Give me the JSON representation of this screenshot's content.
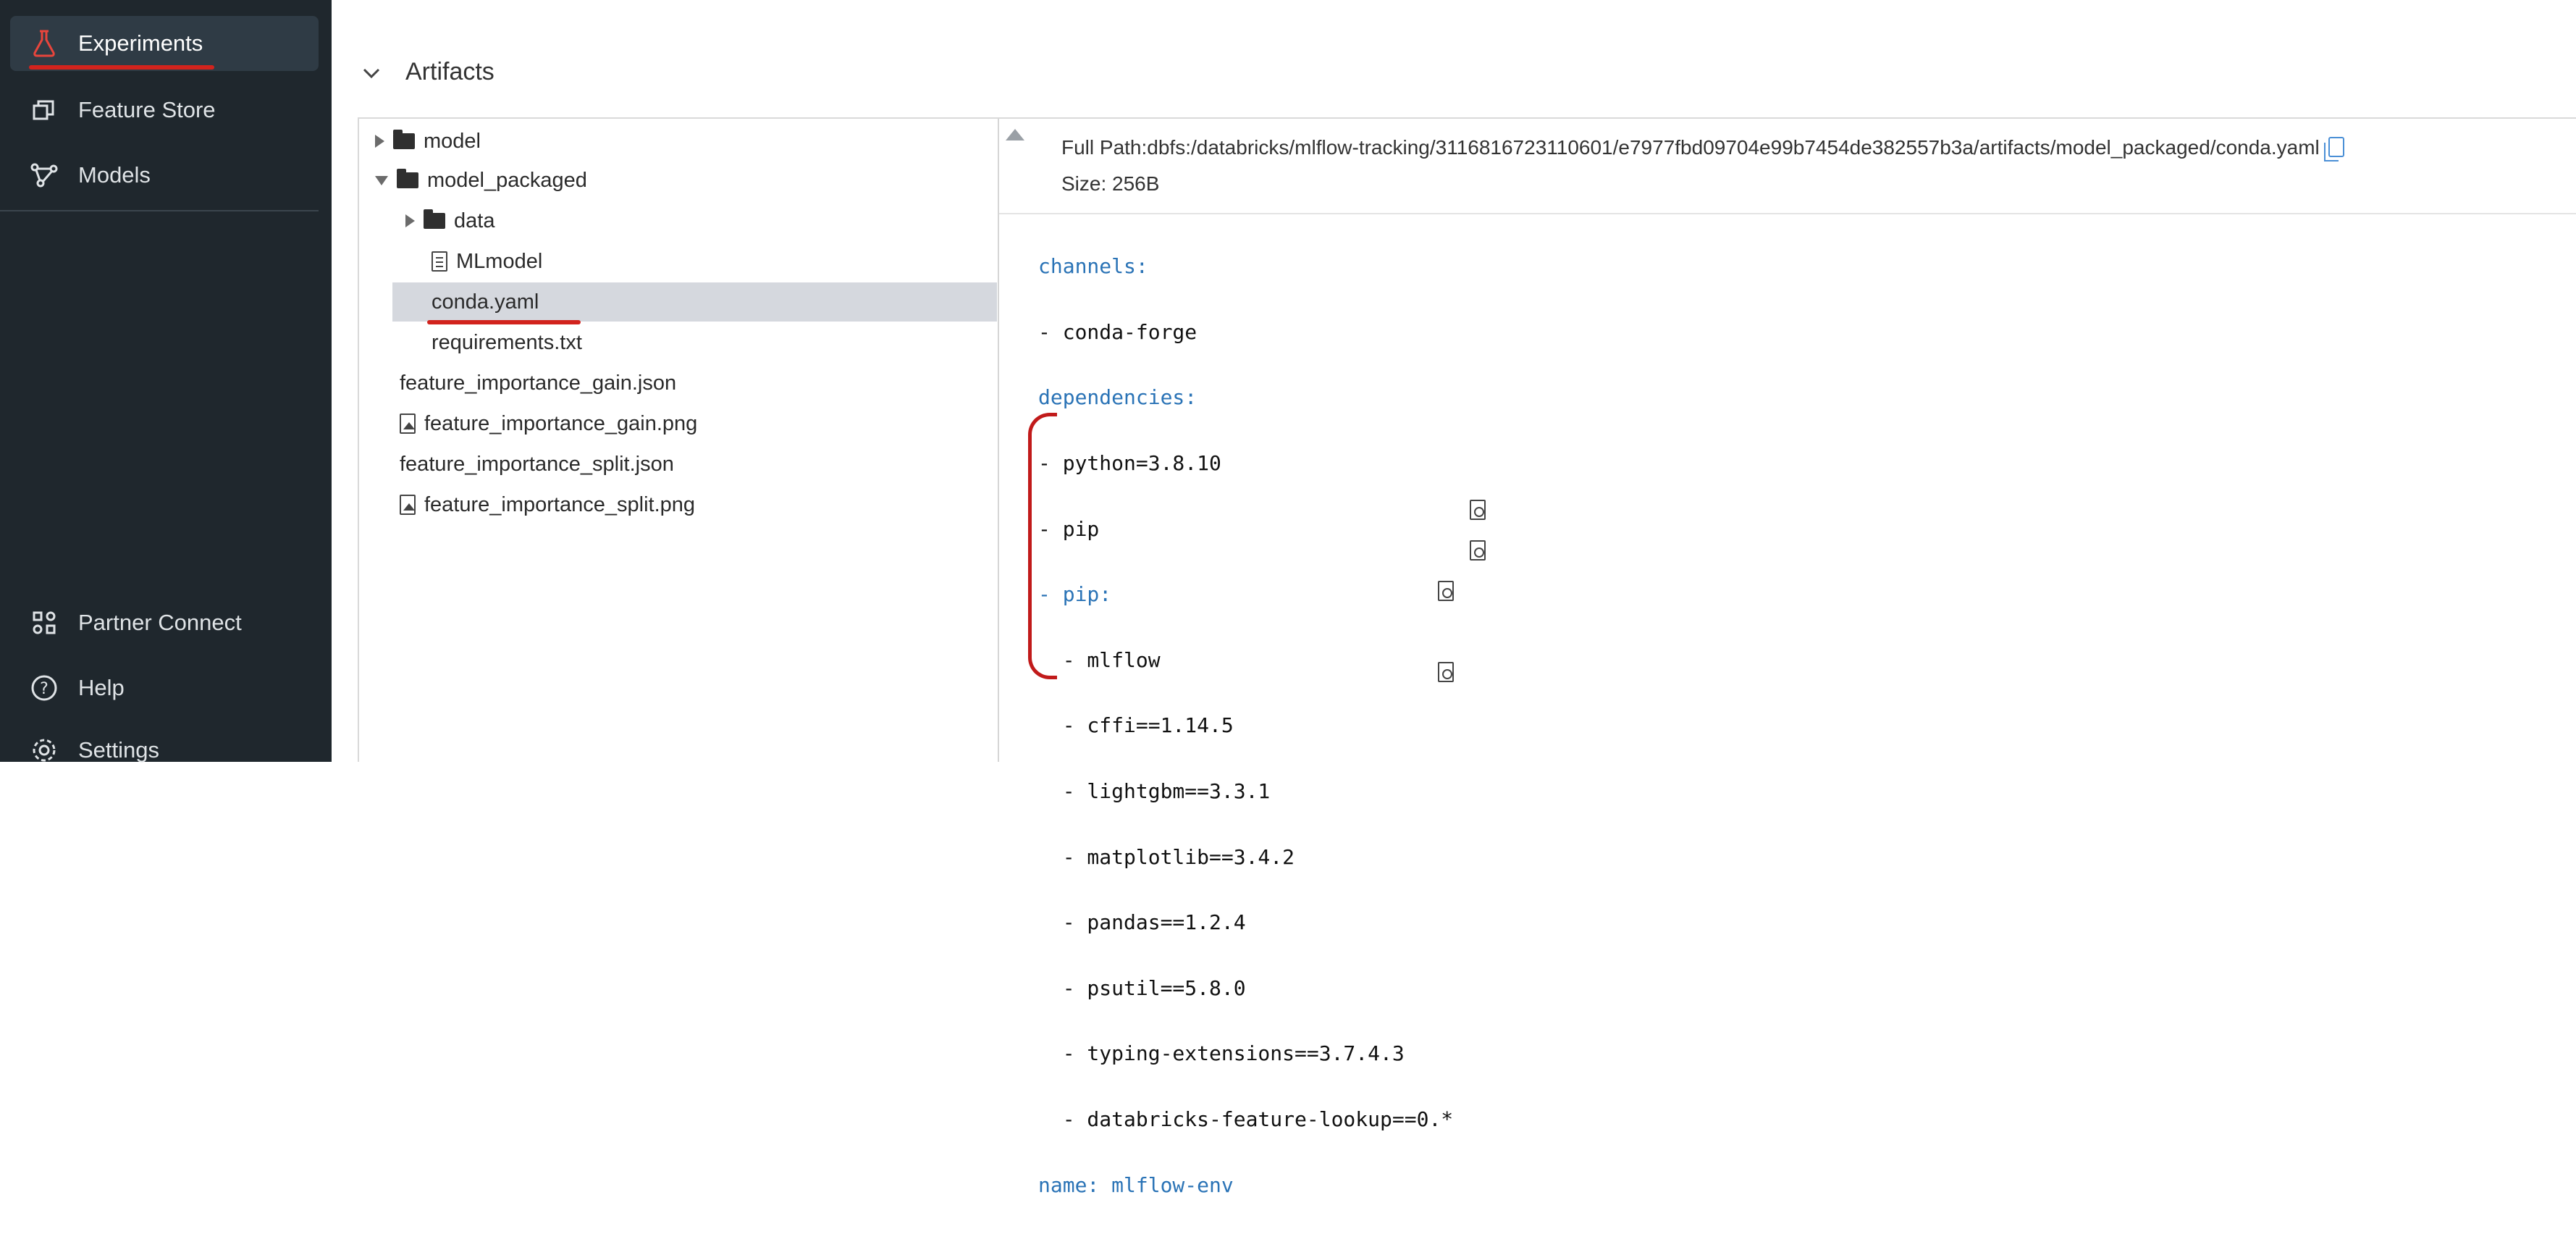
{
  "sidebar": {
    "items": [
      {
        "label": "Experiments",
        "icon": "flask-icon",
        "active": true
      },
      {
        "label": "Feature Store",
        "icon": "feature-store-icon"
      },
      {
        "label": "Models",
        "icon": "models-icon"
      },
      {
        "label": "Partner Connect",
        "icon": "partner-connect-icon"
      },
      {
        "label": "Help",
        "icon": "help-icon"
      },
      {
        "label": "Settings",
        "icon": "settings-icon"
      }
    ]
  },
  "section": {
    "title": "Artifacts"
  },
  "tree": [
    {
      "label": "model",
      "type": "folder",
      "expanded": false
    },
    {
      "label": "model_packaged",
      "type": "folder",
      "expanded": true
    },
    {
      "label": "data",
      "type": "folder",
      "expanded": false
    },
    {
      "label": "MLmodel",
      "type": "file"
    },
    {
      "label": "conda.yaml",
      "type": "file",
      "selected": true
    },
    {
      "label": "requirements.txt",
      "type": "file"
    },
    {
      "label": "feature_importance_gain.json",
      "type": "file"
    },
    {
      "label": "feature_importance_gain.png",
      "type": "image"
    },
    {
      "label": "feature_importance_split.json",
      "type": "file"
    },
    {
      "label": "feature_importance_split.png",
      "type": "image"
    }
  ],
  "details": {
    "full_path": "Full Path:dbfs:/databricks/mlflow-tracking/3116816723110601/e7977fbd09704e99b7454de382557b3a/artifacts/model_packaged/conda.yaml",
    "size": "Size: 256B"
  },
  "code_lines": [
    "channels:",
    "- conda-forge",
    "dependencies:",
    "- python=3.8.10",
    "- pip",
    "- pip:",
    "  - mlflow",
    "  - cffi==1.14.5",
    "  - lightgbm==3.3.1",
    "  - matplotlib==3.4.2",
    "  - pandas==1.2.4",
    "  - psutil==5.8.0",
    "  - typing-extensions==3.7.4.3",
    "  - databricks-feature-lookup==0.*",
    "name: mlflow-env"
  ],
  "colors": {
    "annotation_red": "#d2231d",
    "sidebar_bg": "#1f272d",
    "selected_bg": "#d5d8de",
    "yaml_key": "#2a73b6"
  }
}
